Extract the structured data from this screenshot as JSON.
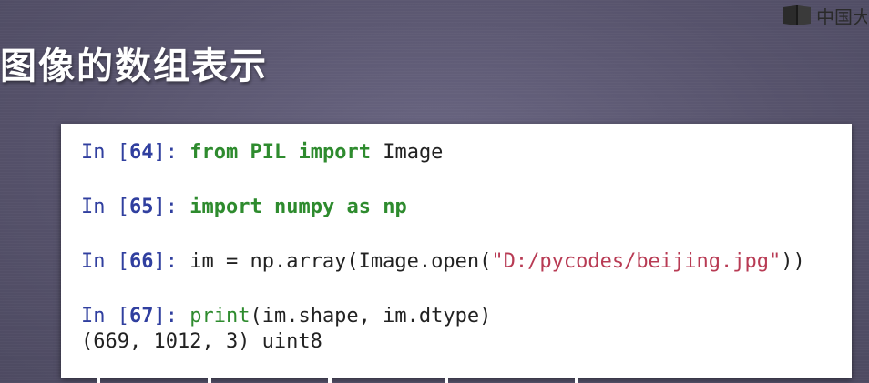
{
  "logo": {
    "text": "中国大",
    "icon": "book-logo-icon"
  },
  "slide": {
    "title": "图像的数组表示"
  },
  "notebook": {
    "cells": [
      {
        "prompt_prefix": "In [",
        "prompt_number": "64",
        "prompt_suffix": "]: ",
        "kw1": "from",
        "mod": "PIL",
        "kw2": "import",
        "name": "Image"
      },
      {
        "prompt_prefix": "In [",
        "prompt_number": "65",
        "prompt_suffix": "]: ",
        "kw1": "import",
        "mod": "numpy",
        "kw2": "as",
        "name": "np"
      },
      {
        "prompt_prefix": "In [",
        "prompt_number": "66",
        "prompt_suffix": "]: ",
        "code_before": "im = np.array(Image.open(",
        "string": "\"D:/pycodes/beijing.jpg\"",
        "code_after": "))"
      },
      {
        "prompt_prefix": "In [",
        "prompt_number": "67",
        "prompt_suffix": "]: ",
        "builtin": "print",
        "code_after": "(im.shape, im.dtype)",
        "output": "(669, 1012, 3) uint8"
      }
    ]
  },
  "colors": {
    "background": "#5a5670",
    "prompt": "#303f9f",
    "keyword": "#2e8b2e",
    "string": "#b83b54"
  }
}
